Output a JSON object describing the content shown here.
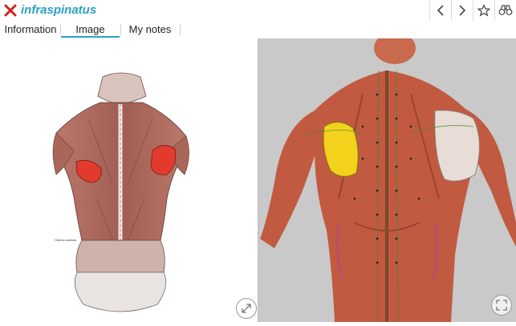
{
  "header": {
    "title": "infraspinatus",
    "close_icon": "close-icon",
    "accent": "#2a9fc6",
    "close_color": "#d61f1f"
  },
  "toolbar": {
    "buttons": [
      "chevron-left-icon",
      "chevron-right-icon",
      "star-icon",
      "binoculars-icon"
    ]
  },
  "tabs": [
    {
      "label": "Information",
      "active": false
    },
    {
      "label": "Image",
      "active": true
    },
    {
      "label": "My notes",
      "active": false
    }
  ],
  "left_image": {
    "caption": "Gluteus minimus",
    "highlight_color": "#e23b2e"
  },
  "right_image": {
    "highlight_color": "#f2d21b",
    "background": "#c9c9c9"
  },
  "controls": {
    "expand_left_icon": "expand-diagonal-icon",
    "expand_right_icon": "fullscreen-icon"
  }
}
